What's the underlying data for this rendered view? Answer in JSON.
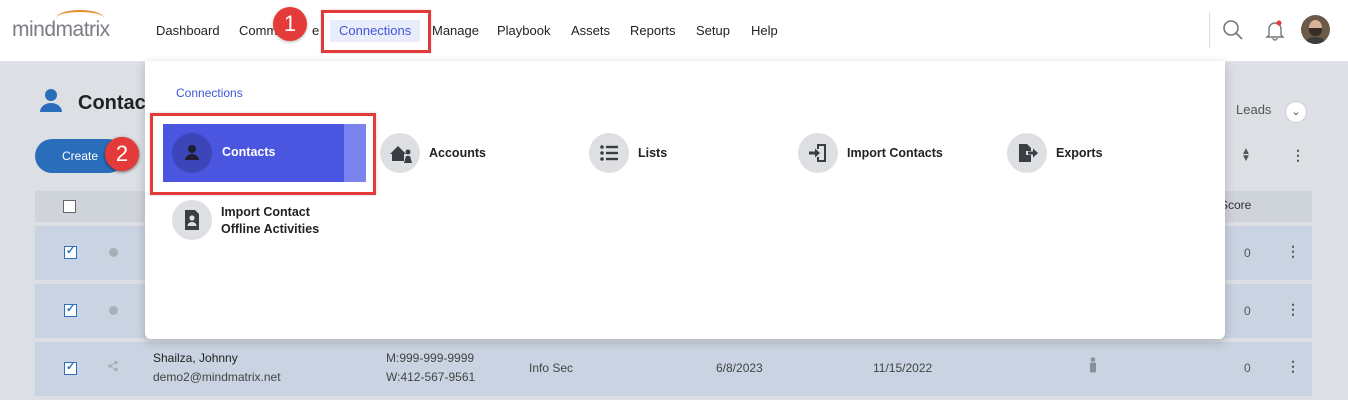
{
  "app": {
    "logo_text": "mindmatrix"
  },
  "nav": {
    "items": [
      "Dashboard",
      "Comm",
      "e",
      "Connections",
      "Manage",
      "Playbook",
      "Assets",
      "Reports",
      "Setup",
      "Help"
    ],
    "active": "Connections"
  },
  "annotations": {
    "step1": "1",
    "step2": "2"
  },
  "page": {
    "title": "Contac",
    "create_label": "Create",
    "leads_label": "Leads",
    "score_header": "Score"
  },
  "dropdown": {
    "title": "Connections",
    "items": [
      {
        "label": "Contacts",
        "icon": "person-icon"
      },
      {
        "label": "Accounts",
        "icon": "house-person-icon"
      },
      {
        "label": "Lists",
        "icon": "list-icon"
      },
      {
        "label": "Import Contacts",
        "icon": "import-icon"
      },
      {
        "label": "Exports",
        "icon": "export-icon"
      },
      {
        "label_line1": "Import Contact",
        "label_line2": "Offline Activities",
        "icon": "contact-file-icon"
      }
    ]
  },
  "rows": [
    {
      "checked": true,
      "score": "0"
    },
    {
      "checked": true,
      "score": "0"
    },
    {
      "checked": true,
      "name": "Shailza, Johnny",
      "email": "demo2@mindmatrix.net",
      "mobile": "M:999-999-9999",
      "work": "W:412-567-9561",
      "dept": "Info Sec",
      "date1": "6/8/2023",
      "date2": "11/15/2022",
      "score": "0"
    }
  ],
  "colors": {
    "accent": "#3f56d9",
    "highlight": "#e53a3a",
    "active_item": "#4a55e0",
    "primary_button": "#2a6ebb"
  }
}
